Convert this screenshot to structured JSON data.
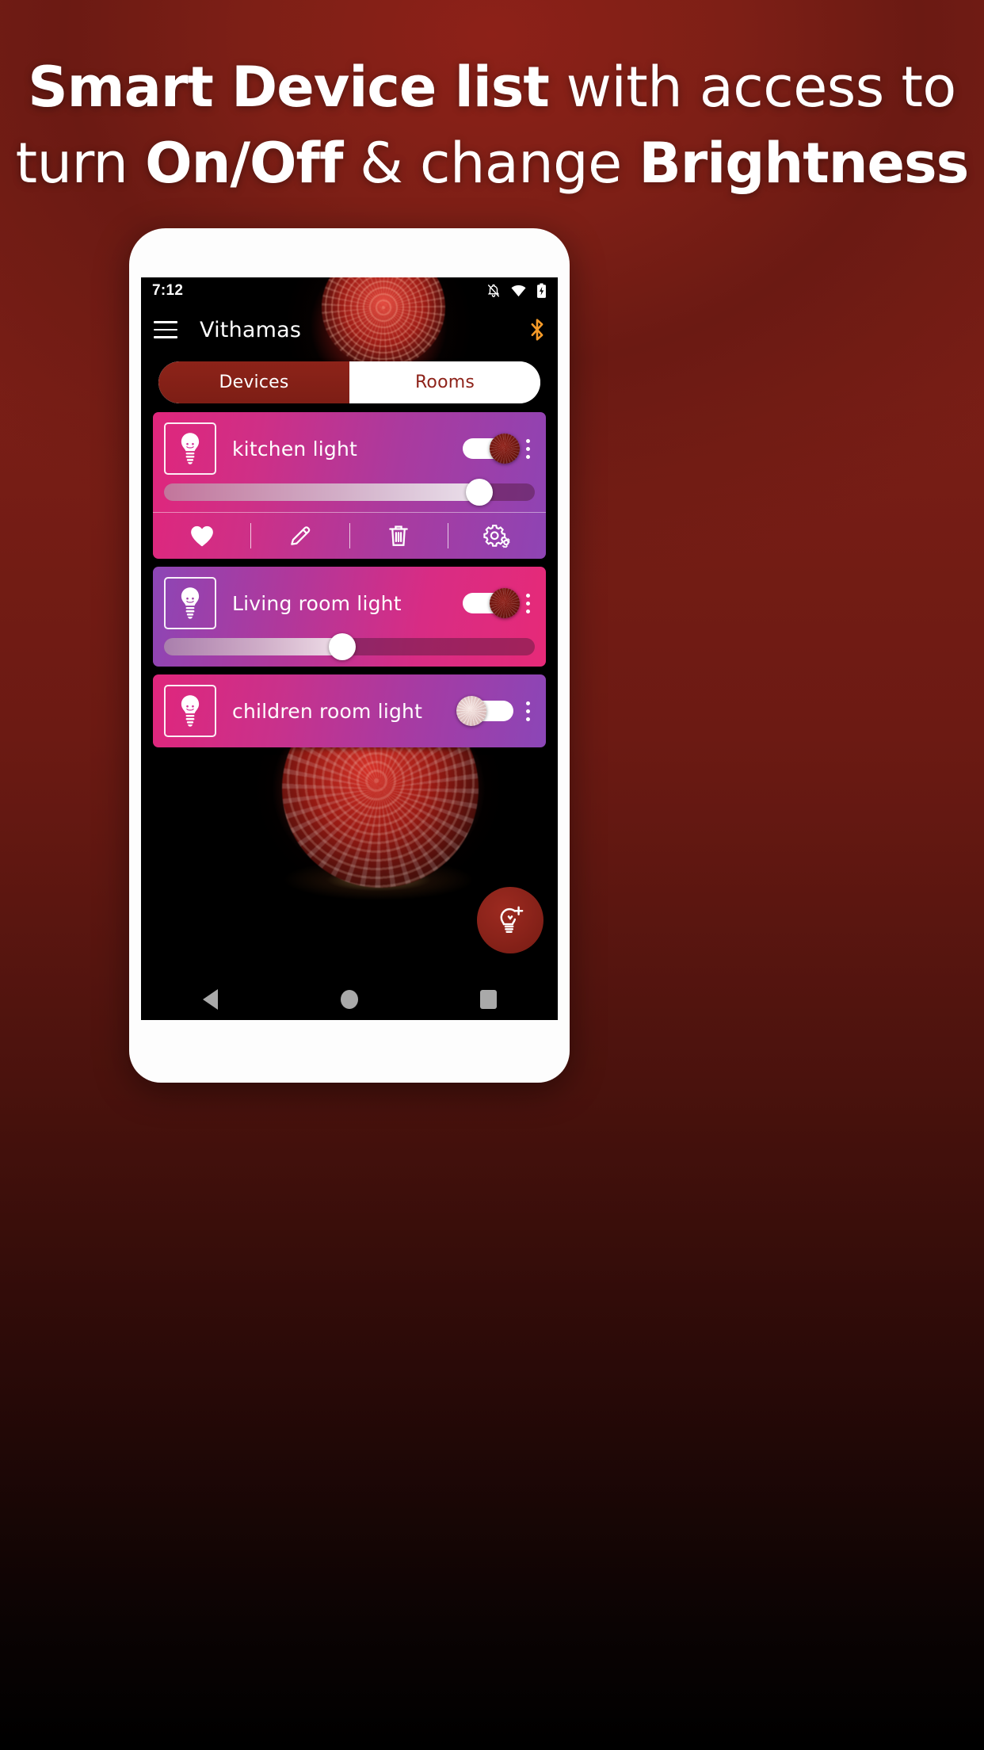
{
  "poster": {
    "headline_line1_bold": "Smart Device list",
    "headline_line1_rest": " with access to",
    "headline_line2_pre": "turn ",
    "headline_line2_bold1": "On/Off",
    "headline_line2_mid": " & change ",
    "headline_line2_bold2": "Brightness",
    "background_color": "#7a1e16"
  },
  "phone": {
    "status_bar": {
      "time": "7:12",
      "icons": [
        "bell-off-icon",
        "wifi-icon",
        "battery-charging-icon"
      ]
    },
    "app_bar": {
      "menu_icon": "hamburger-menu-icon",
      "title": "Vithamas",
      "bluetooth_icon": "bluetooth-icon",
      "bluetooth_color": "#f59a28"
    },
    "tabs": {
      "items": [
        {
          "label": "Devices",
          "active": true
        },
        {
          "label": "Rooms",
          "active": false
        }
      ],
      "active_bg": "#8d2319",
      "inactive_bg": "#ffffff",
      "inactive_text": "#8e231a"
    },
    "devices": [
      {
        "name": "kitchen light",
        "icon": "lightbulb-icon",
        "power_on": true,
        "brightness_percent": 85,
        "expanded": true,
        "actions": [
          {
            "label": "Favorite",
            "icon": "heart-icon"
          },
          {
            "label": "Edit",
            "icon": "pencil-icon"
          },
          {
            "label": "Delete",
            "icon": "trash-icon"
          },
          {
            "label": "Settings",
            "icon": "gears-icon"
          }
        ]
      },
      {
        "name": "Living room light",
        "icon": "lightbulb-icon",
        "power_on": true,
        "brightness_percent": 48,
        "expanded": false,
        "actions": []
      },
      {
        "name": "children room light",
        "icon": "lightbulb-icon",
        "power_on": false,
        "brightness_percent": null,
        "expanded": false,
        "actions": []
      }
    ],
    "fab": {
      "label": "Add device",
      "icon": "bulb-plus-icon",
      "color": "#8a231a"
    },
    "nav_bar": {
      "back": "back-triangle-icon",
      "home": "home-circle-icon",
      "recents": "recents-square-icon"
    }
  }
}
